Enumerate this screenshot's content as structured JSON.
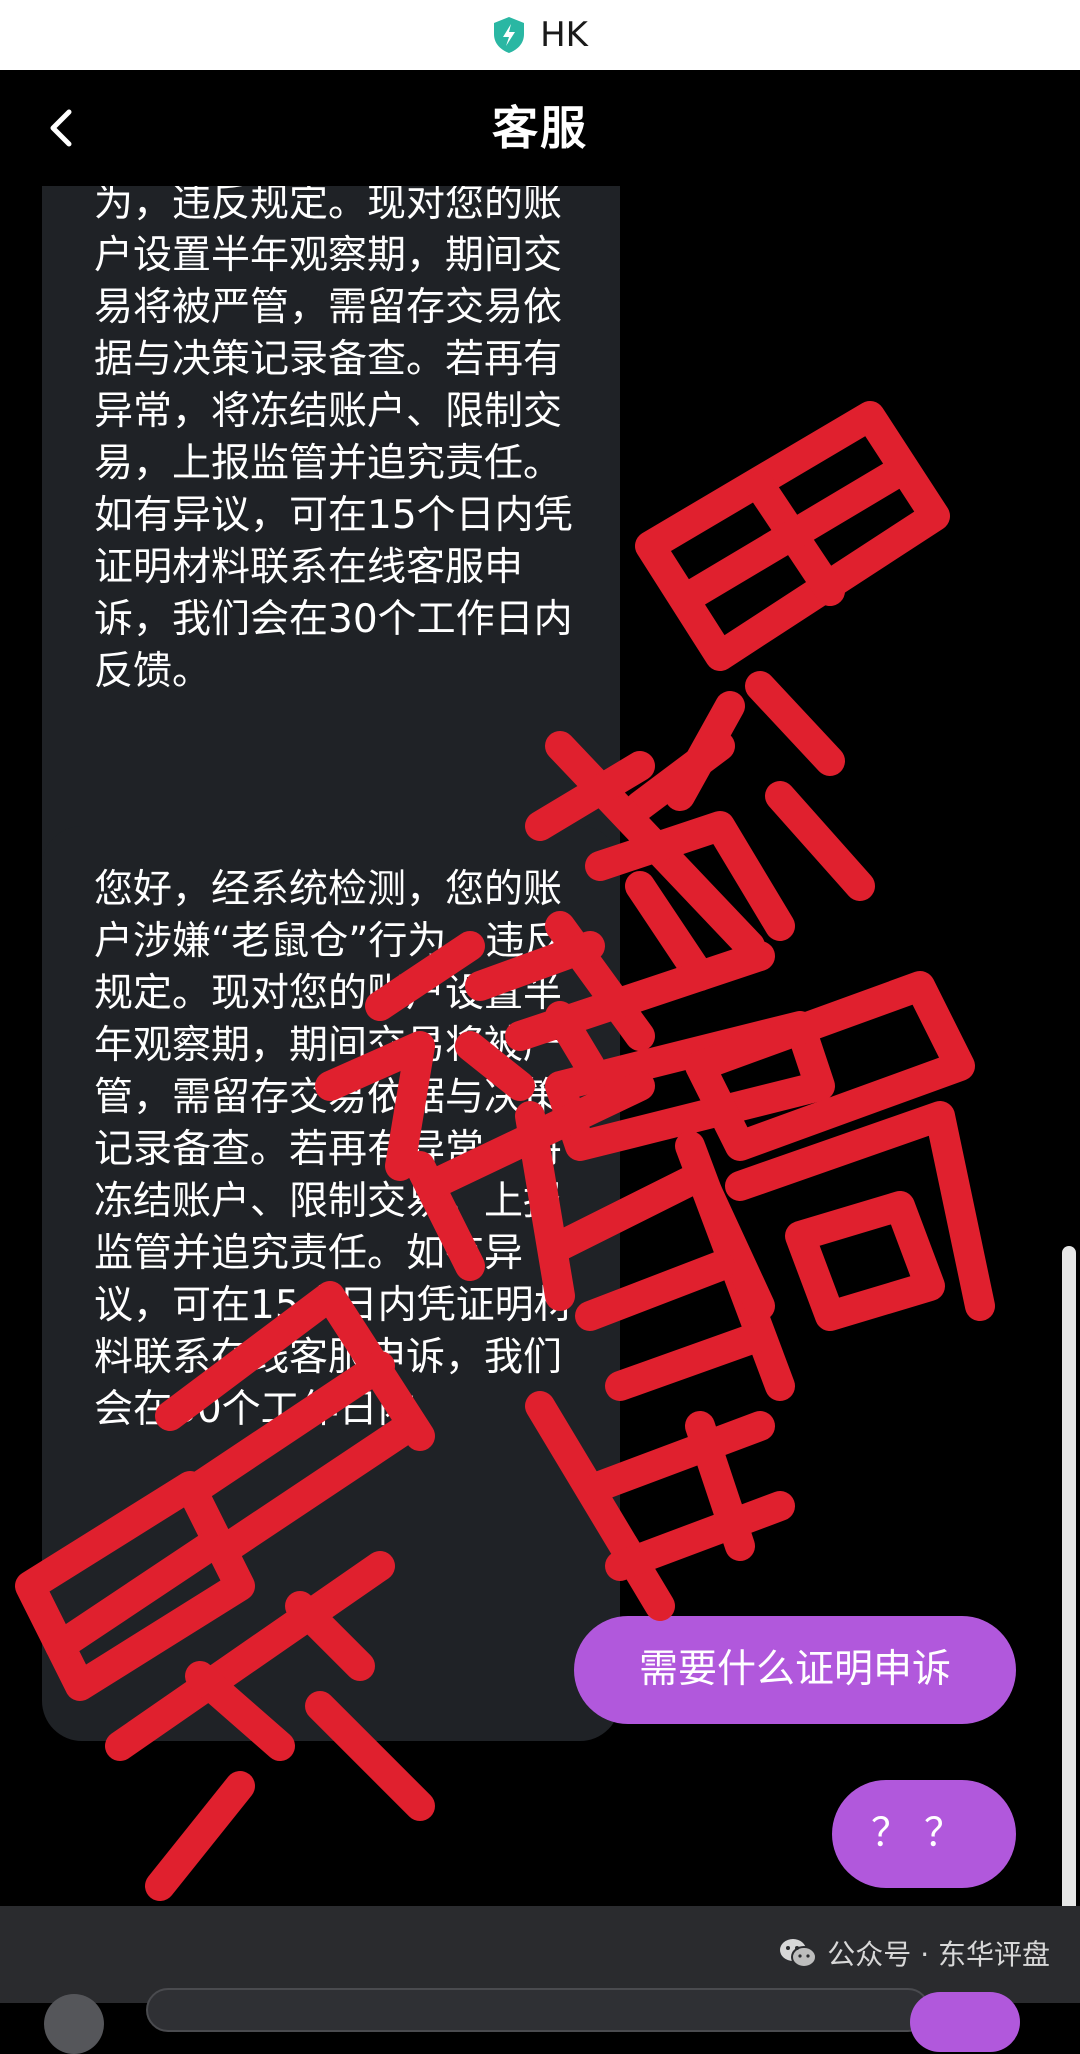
{
  "top_bar": {
    "domain": "HK",
    "shield_icon": "shield-bolt-icon"
  },
  "nav": {
    "title": "客服",
    "back_icon": "chevron-left-icon"
  },
  "messages": [
    {
      "from": "service",
      "text": "为，违反规定。现对您的账户设置半年观察期，期间交易将被严管，需留存交易依据与决策记录备查。若再有异常，将冻结账户、限制交易，上报监管并追究责任。如有异议，可在15个日内凭证明材料联系在线客服申诉，我们会在30个工作日内反馈。"
    },
    {
      "from": "service",
      "text": "您好，经系统检测，您的账户涉嫌“老鼠仓”行为，违反规定。现对您的账户设置半年观察期，期间交易将被严管，需留存交易依据与决策记录备查。若再有异常，将冻结账户、限制交易，上报监管并追究责任。如有异议，可在15个日内凭证明材料联系在线客服申诉，我们会在30个工作日内"
    },
    {
      "from": "user",
      "text": "需要什么证明申诉"
    },
    {
      "from": "user",
      "text": "？？"
    }
  ],
  "watermark": {
    "text": "东华评盘 曝光 骗局",
    "color": "#e0202e"
  },
  "footer": {
    "credit": "公众号 · 东华评盘",
    "credit_icon": "wechat-icon"
  },
  "colors": {
    "bubble_incoming": "#1f2226",
    "bubble_outgoing": "#b158dc",
    "background": "#000000"
  }
}
